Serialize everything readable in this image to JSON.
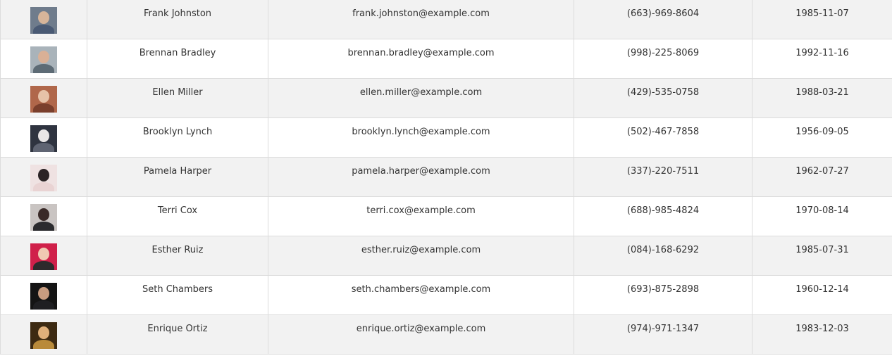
{
  "rows": [
    {
      "name": "Frank Johnston",
      "email": "frank.johnston@example.com",
      "phone": "(663)-969-8604",
      "dob": "1985-11-07",
      "avatar": {
        "bg": "#6f7c8c",
        "head": "#d7b59a",
        "body": "#4a5a74"
      }
    },
    {
      "name": "Brennan Bradley",
      "email": "brennan.bradley@example.com",
      "phone": "(998)-225-8069",
      "dob": "1992-11-16",
      "avatar": {
        "bg": "#a9b3ba",
        "head": "#d9b096",
        "body": "#5d6b75"
      }
    },
    {
      "name": "Ellen Miller",
      "email": "ellen.miller@example.com",
      "phone": "(429)-535-0758",
      "dob": "1988-03-21",
      "avatar": {
        "bg": "#b0674a",
        "head": "#e6c2a8",
        "body": "#7a3f2c"
      }
    },
    {
      "name": "Brooklyn Lynch",
      "email": "brooklyn.lynch@example.com",
      "phone": "(502)-467-7858",
      "dob": "1956-09-05",
      "avatar": {
        "bg": "#2f3440",
        "head": "#e9e6e6",
        "body": "#5f6472"
      }
    },
    {
      "name": "Pamela Harper",
      "email": "pamela.harper@example.com",
      "phone": "(337)-220-7511",
      "dob": "1962-07-27",
      "avatar": {
        "bg": "#efe2e2",
        "head": "#2b2325",
        "body": "#e9d3d3"
      }
    },
    {
      "name": "Terri Cox",
      "email": "terri.cox@example.com",
      "phone": "(688)-985-4824",
      "dob": "1970-08-14",
      "avatar": {
        "bg": "#c9c4c2",
        "head": "#3a2a28",
        "body": "#2b2b2e"
      }
    },
    {
      "name": "Esther Ruiz",
      "email": "esther.ruiz@example.com",
      "phone": "(084)-168-6292",
      "dob": "1985-07-31",
      "avatar": {
        "bg": "#d0204a",
        "head": "#f0c9b2",
        "body": "#2e2a2c"
      }
    },
    {
      "name": "Seth Chambers",
      "email": "seth.chambers@example.com",
      "phone": "(693)-875-2898",
      "dob": "1960-12-14",
      "avatar": {
        "bg": "#141414",
        "head": "#c89c80",
        "body": "#1f1f22"
      }
    },
    {
      "name": "Enrique Ortiz",
      "email": "enrique.ortiz@example.com",
      "phone": "(974)-971-1347",
      "dob": "1983-12-03",
      "avatar": {
        "bg": "#3d2a12",
        "head": "#e0b07a",
        "body": "#b98a3a"
      }
    }
  ]
}
